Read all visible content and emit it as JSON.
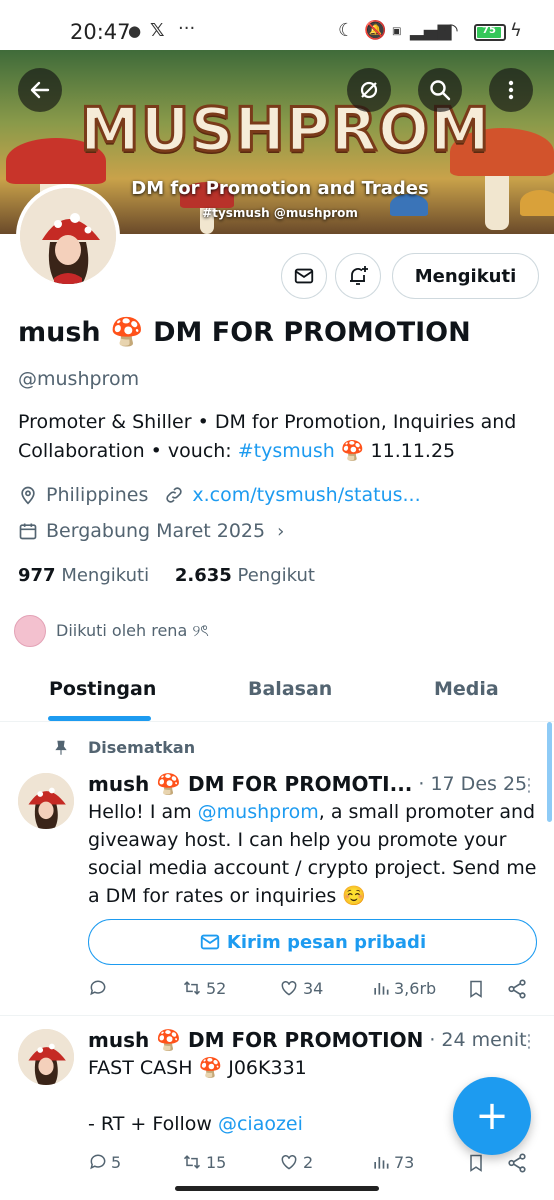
{
  "status_bar": {
    "time": "20:47",
    "battery": "75"
  },
  "banner": {
    "title": "MUSHPROM",
    "subtitle": "DM for Promotion and Trades",
    "tags": "#tysmush @mushprom"
  },
  "profile": {
    "name": "mush",
    "name_emoji": "🍄",
    "name_rest": "DM FOR PROMOTION",
    "handle": "@mushprom",
    "bio_text": "Promoter & Shiller • DM for Promotion, Inquiries and Collaboration • vouch: ",
    "bio_hashtag": "#tysmush",
    "bio_end": " 🍄 11.11.25",
    "location": "Philippines",
    "url": "x.com/tysmush/status...",
    "joined": "Bergabung Maret 2025",
    "following_count": "977",
    "following_label": "Mengikuti",
    "followers_count": "2.635",
    "followers_label": "Pengikut",
    "followed_by": "Diikuti oleh rena ୨ৎ",
    "follow_button": "Mengikuti"
  },
  "tabs": [
    {
      "label": "Postingan"
    },
    {
      "label": "Balasan"
    },
    {
      "label": "Media"
    }
  ],
  "pinned_label": "Disematkan",
  "posts": [
    {
      "name": "mush 🍄 DM FOR PROMOTI...",
      "time": "· 17 Des 25",
      "text_before": "Hello! I am ",
      "mention": "@mushprom",
      "text_after": ", a small promoter and giveaway host. I can help you promote your social media account / crypto project. Send me a DM for rates or inquiries ☺️",
      "dm_button": "Kirim pesan pribadi",
      "replies": "",
      "reposts": "52",
      "likes": "34",
      "views": "3,6rb"
    },
    {
      "name": "mush 🍄 DM FOR PROMOTION",
      "time": "· 24 menit",
      "line1": "FAST CASH 🍄 J06K331",
      "line2": "- RT + Follow ",
      "mention": "@ciaozei",
      "replies": "5",
      "reposts": "15",
      "likes": "2",
      "views": "73"
    }
  ]
}
